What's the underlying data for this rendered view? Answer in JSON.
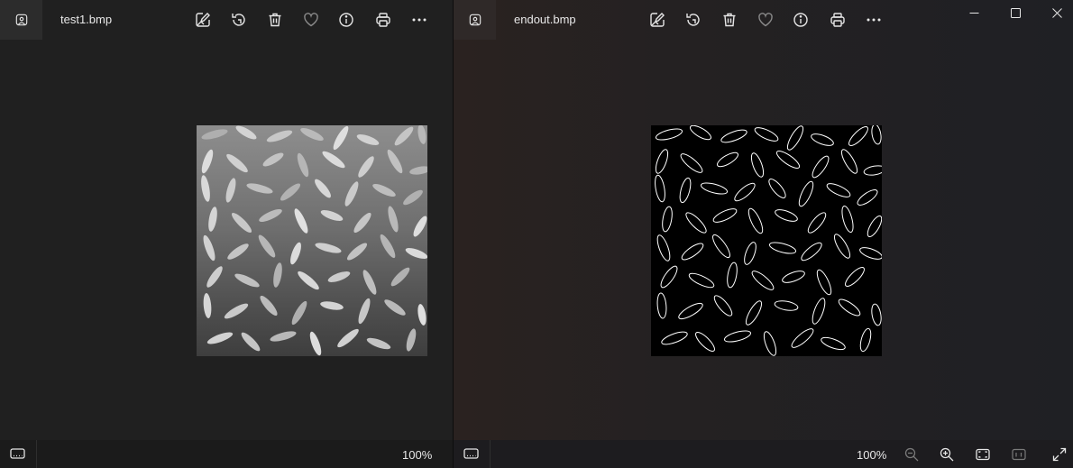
{
  "left_window": {
    "filename": "test1.bmp",
    "zoom": "100%"
  },
  "right_window": {
    "filename": "endout.bmp",
    "zoom": "100%"
  },
  "toolbar_icons": [
    "edit-image-icon",
    "rotate-icon",
    "delete-icon",
    "favorite-heart-icon",
    "info-icon",
    "print-icon",
    "more-options-icon"
  ],
  "statusbar_icons": [
    "filmstrip-icon",
    "zoom-out-icon",
    "zoom-in-icon",
    "fit-to-window-icon",
    "actual-size-icon",
    "fullscreen-icon"
  ],
  "caption_buttons": [
    "minimize-icon",
    "maximize-icon",
    "close-icon"
  ],
  "colors": {
    "left_background": "#202020",
    "right_background_start": "#2a2220",
    "right_background_end": "#1f2024",
    "icon": "#e6e6e6",
    "dim_icon": "#8a8a8a"
  }
}
